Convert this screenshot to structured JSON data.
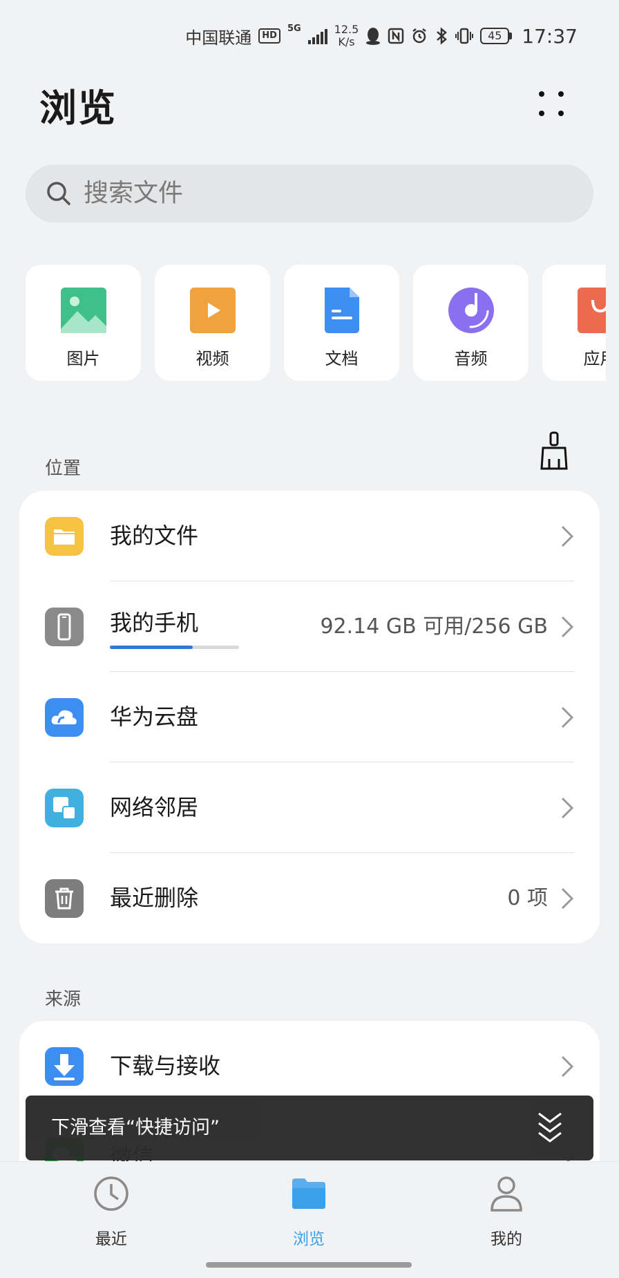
{
  "status_bar": {
    "carrier": "中国联通",
    "hd": "HD",
    "network": "5G",
    "speed_value": "12.5",
    "speed_unit": "K/s",
    "battery": "45",
    "time": "17:37"
  },
  "header": {
    "title": "浏览"
  },
  "search": {
    "placeholder": "搜索文件"
  },
  "categories": [
    {
      "label": "图片",
      "icon": "image-icon",
      "color": "#3fbf8a"
    },
    {
      "label": "视频",
      "icon": "video-icon",
      "color": "#f0a23c"
    },
    {
      "label": "文档",
      "icon": "document-icon",
      "color": "#3d8ef0"
    },
    {
      "label": "音频",
      "icon": "audio-icon",
      "color": "#8a6ff0"
    },
    {
      "label": "应用",
      "icon": "app-icon",
      "color": "#ec6a4f"
    }
  ],
  "locations": {
    "title": "位置",
    "items": [
      {
        "label": "我的文件",
        "right": "",
        "icon": "folder-icon"
      },
      {
        "label": "我的手机",
        "right": "92.14 GB 可用/256 GB",
        "icon": "phone-icon",
        "storage_used_fraction": 0.64
      },
      {
        "label": "华为云盘",
        "right": "",
        "icon": "cloud-icon"
      },
      {
        "label": "网络邻居",
        "right": "",
        "icon": "network-icon"
      },
      {
        "label": "最近删除",
        "right": "0 项",
        "icon": "trash-icon"
      }
    ]
  },
  "sources": {
    "title": "来源",
    "items": [
      {
        "label": "下载与接收",
        "icon": "download-icon"
      },
      {
        "label": "微信",
        "icon": "wechat-icon"
      }
    ]
  },
  "toast": {
    "text": "下滑查看“快捷访问”"
  },
  "nav": {
    "items": [
      {
        "label": "最近",
        "icon": "clock-icon"
      },
      {
        "label": "浏览",
        "icon": "folder-icon"
      },
      {
        "label": "我的",
        "icon": "person-icon"
      }
    ],
    "active": "浏览"
  },
  "colors": {
    "accent": "#3aa0ea",
    "background": "#f1f2f4",
    "toast_bg": "#2b2b2b"
  }
}
